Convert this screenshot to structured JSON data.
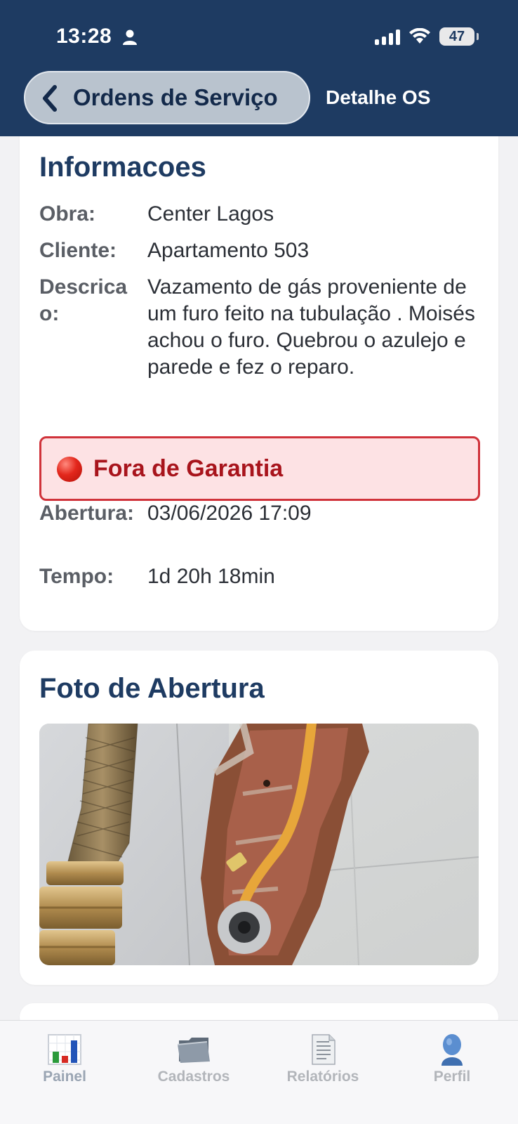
{
  "status_bar": {
    "time": "13:28",
    "battery": "47",
    "icons": [
      "person-icon",
      "signal-icon",
      "wifi-icon",
      "battery-icon"
    ]
  },
  "nav": {
    "back_label": "Ordens de Serviço",
    "title": "Detalhe OS"
  },
  "info": {
    "title": "Informacoes",
    "rows": [
      {
        "label": "Obra:",
        "value": "Center Lagos"
      },
      {
        "label": "Cliente:",
        "value": "Apartamento 503"
      },
      {
        "label": "Descricao:",
        "value": "Vazamento de gás proveniente de um furo feito na tubulação . Moisés achou o furo.  Quebrou o azulejo e parede e fez o reparo."
      },
      {
        "label": "Abertura:",
        "value": "03/06/2026 17:09"
      },
      {
        "label": "Tempo:",
        "value": "1d 20h 18min"
      }
    ],
    "warranty": {
      "icon": "red-circle-icon",
      "label": "Fora de Garantia"
    }
  },
  "foto": {
    "title": "Foto de Abertura"
  },
  "tabs": [
    {
      "label": "Painel",
      "icon": "chart-icon"
    },
    {
      "label": "Cadastros",
      "icon": "folder-icon"
    },
    {
      "label": "Relatórios",
      "icon": "document-icon"
    },
    {
      "label": "Perfil",
      "icon": "person-icon"
    }
  ],
  "colors": {
    "header": "#1e3b62",
    "title": "#1e3b62",
    "warranty_bg": "#fde2e4",
    "warranty_border": "#d0323a",
    "warranty_text": "#a8141c"
  }
}
